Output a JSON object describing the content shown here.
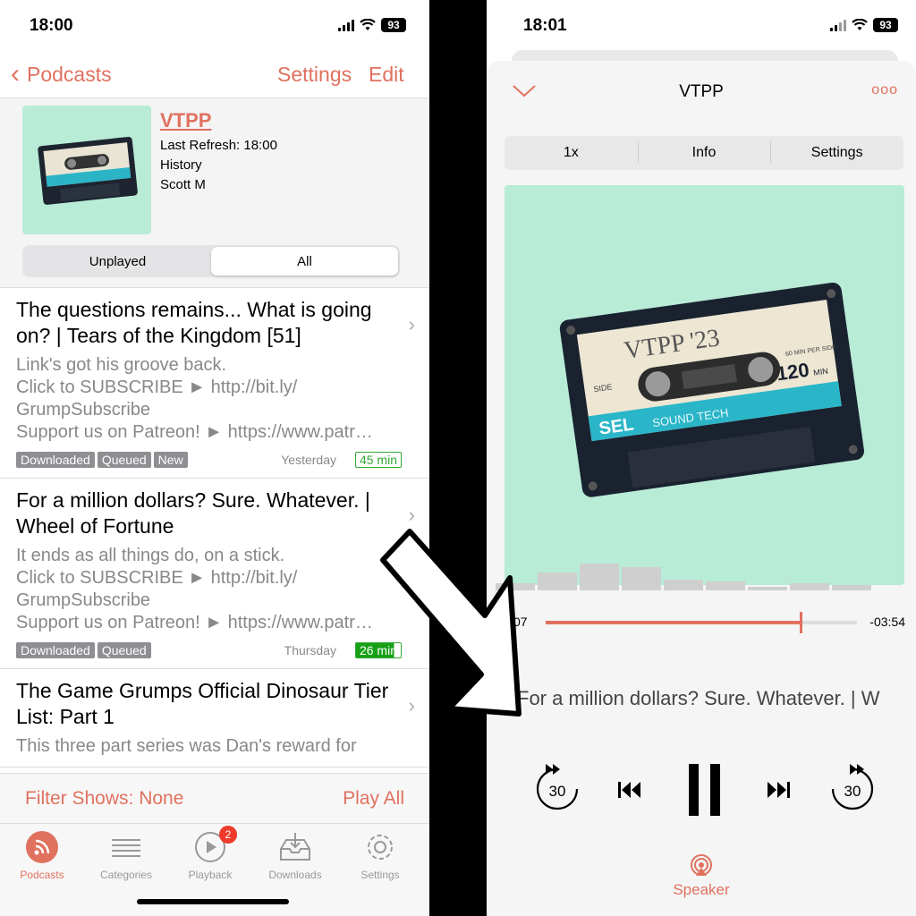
{
  "left": {
    "status": {
      "time": "18:00",
      "battery": "93"
    },
    "nav": {
      "back_label": "Podcasts",
      "settings_label": "Settings",
      "edit_label": "Edit"
    },
    "podcast": {
      "title": "VTPP",
      "last_refresh": "Last Refresh: 18:00",
      "category": "History",
      "author": "Scott M"
    },
    "segment": {
      "options": [
        "Unplayed",
        "All"
      ],
      "selected": "All"
    },
    "episodes": [
      {
        "title": "The questions remains... What is going on? | Tears of the Kingdom [51]",
        "desc1": "Link's got his groove back.",
        "desc2": "Click to SUBSCRIBE ► http://bit.ly/",
        "desc3": "GrumpSubscribe",
        "desc4": "Support us on Patreon! ► https://www.patr…",
        "tags": [
          "Downloaded",
          "Queued",
          "New"
        ],
        "date": "Yesterday",
        "duration": "45 min",
        "progress": 0
      },
      {
        "title": "For a million dollars? Sure. Whatever. | Wheel of Fortune",
        "desc1": "It ends as all things do, on a stick.",
        "desc2": "Click to SUBSCRIBE ► http://bit.ly/",
        "desc3": "GrumpSubscribe",
        "desc4": "Support us on Patreon! ► https://www.patr…",
        "tags": [
          "Downloaded",
          "Queued"
        ],
        "date": "Thursday",
        "duration": "26 min",
        "progress": 0.85
      },
      {
        "title": "The Game Grumps Official Dinosaur Tier List: Part 1",
        "desc1": "This three part series was Dan's reward for"
      }
    ],
    "filter": {
      "label": "Filter Shows: None",
      "play_all": "Play All"
    },
    "tabs": [
      {
        "label": "Podcasts",
        "icon": "podcast-icon"
      },
      {
        "label": "Categories",
        "icon": "list-icon"
      },
      {
        "label": "Playback",
        "icon": "play-icon",
        "badge": "2"
      },
      {
        "label": "Downloads",
        "icon": "inbox-download-icon"
      },
      {
        "label": "Settings",
        "icon": "gear-icon"
      }
    ],
    "active_tab": "Podcasts"
  },
  "right": {
    "status": {
      "time": "18:01",
      "battery": "93"
    },
    "title": "VTPP",
    "more": "ooo",
    "segment": [
      "1x",
      "Info",
      "Settings"
    ],
    "artwork": {
      "label": "VTPP '23",
      "brand": "SEL",
      "sound_tech": "SOUND TECH",
      "minutes": "120",
      "min_label": "MIN",
      "side_label": "SIDE",
      "per_side": "60 MIN PER SIDE"
    },
    "elapsed": "07",
    "remaining": "-03:54",
    "progress": 0.82,
    "episode_title": "For a million dollars? Sure. Whatever. | W",
    "skip_back": "30",
    "skip_forward": "30",
    "output_label": "Speaker"
  },
  "colors": {
    "accent": "#e0715f",
    "artwork_bg": "#b8ecd7",
    "duration_green": "#17a017",
    "badge_red": "#ee3b2b"
  }
}
